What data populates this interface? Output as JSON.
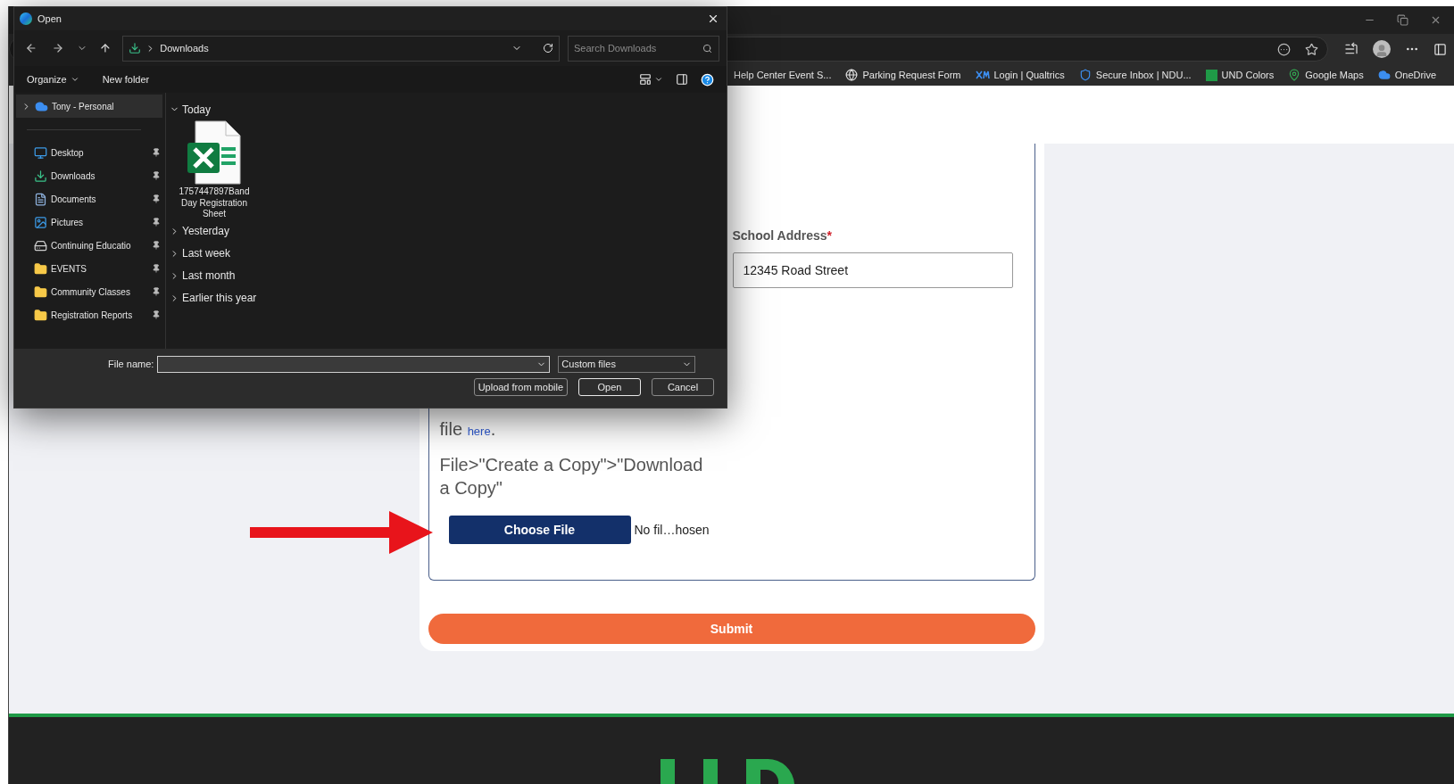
{
  "browser": {
    "bookmarks": [
      {
        "label": "Help Center Event S...",
        "kind": "none"
      },
      {
        "label": "Parking Request Form",
        "kind": "globe"
      },
      {
        "label": "Login | Qualtrics",
        "kind": "xm"
      },
      {
        "label": "Secure Inbox | NDU...",
        "kind": "shield"
      },
      {
        "label": "UND Colors",
        "kind": "und"
      },
      {
        "label": "Google Maps",
        "kind": "pin"
      },
      {
        "label": "OneDrive",
        "kind": "cloud"
      }
    ]
  },
  "form": {
    "address_label": "School Address",
    "required_mark": "*",
    "address_value": "12345 Road Street",
    "info_text": "file",
    "info_link": "here",
    "info_end": ".",
    "copy_text": "File>\"Create a Copy\">\"Download a Copy\"",
    "choose_button": "Choose File",
    "file_status": "No fil…hosen",
    "submit": "Submit"
  },
  "dialog": {
    "title": "Open",
    "path": "Downloads",
    "search_placeholder": "Search Downloads",
    "organize": "Organize",
    "new_folder": "New folder",
    "sidebar": [
      {
        "label": "Tony - Personal",
        "kind": "cloud",
        "selected": true,
        "pinned": false
      },
      {
        "label": "Desktop",
        "kind": "desktop",
        "selected": false,
        "pinned": true
      },
      {
        "label": "Downloads",
        "kind": "download",
        "selected": false,
        "pinned": true
      },
      {
        "label": "Documents",
        "kind": "documents",
        "selected": false,
        "pinned": true
      },
      {
        "label": "Pictures",
        "kind": "pictures",
        "selected": false,
        "pinned": true
      },
      {
        "label": "Continuing Educatio",
        "kind": "drive",
        "selected": false,
        "pinned": true
      },
      {
        "label": "EVENTS",
        "kind": "folder",
        "selected": false,
        "pinned": true
      },
      {
        "label": "Community Classes",
        "kind": "folder",
        "selected": false,
        "pinned": true
      },
      {
        "label": "Registration Reports",
        "kind": "folder",
        "selected": false,
        "pinned": true
      }
    ],
    "groups": [
      {
        "label": "Today",
        "expanded": true,
        "files": [
          "1757447897Band Day Registration Sheet"
        ]
      },
      {
        "label": "Yesterday",
        "expanded": false
      },
      {
        "label": "Last week",
        "expanded": false
      },
      {
        "label": "Last month",
        "expanded": false
      },
      {
        "label": "Earlier this year",
        "expanded": false
      }
    ],
    "file_name_label": "File name:",
    "file_type": "Custom files",
    "buttons": [
      {
        "label": "Upload from mobile",
        "kind": "secondary"
      },
      {
        "label": "Open",
        "kind": "primary"
      },
      {
        "label": "Cancel",
        "kind": "secondary"
      }
    ]
  }
}
